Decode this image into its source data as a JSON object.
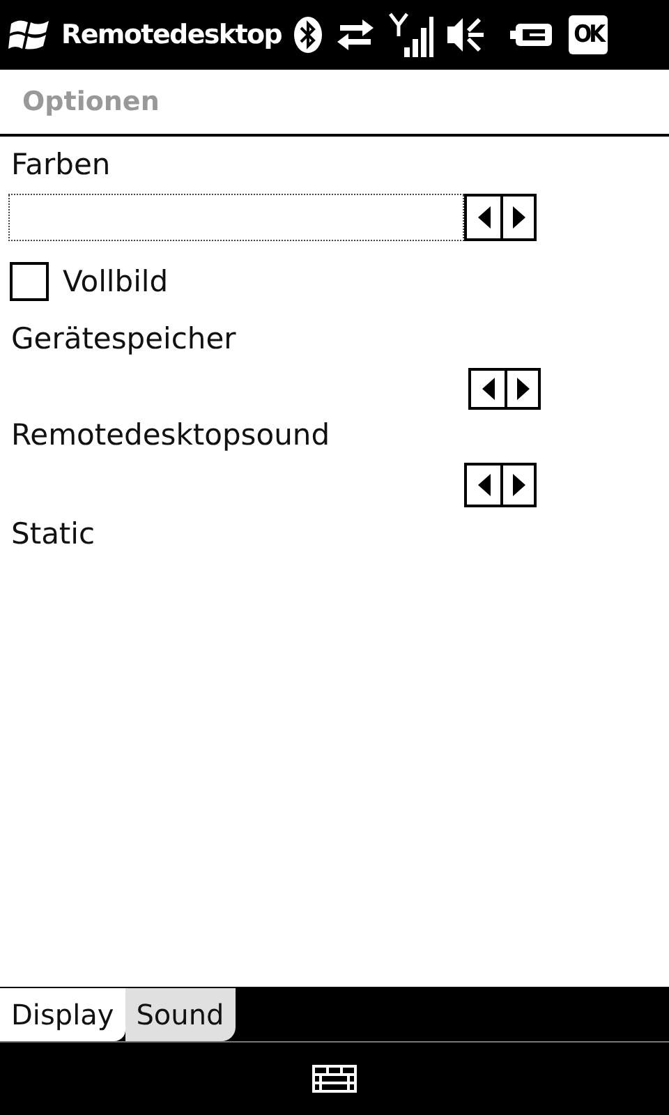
{
  "title_bar": {
    "title": "Remotedesktop",
    "ok": "OK"
  },
  "header": "Optionen",
  "controls": [
    {
      "kind": "combo",
      "label": "Farben"
    },
    {
      "kind": "checkbox",
      "label": "Vollbild",
      "checked": false
    },
    {
      "kind": "spinner",
      "label": "Gerätespeicher"
    },
    {
      "kind": "spinner",
      "label": "Remotedesktopsound"
    },
    {
      "kind": "static",
      "label": "Static"
    }
  ],
  "tabs": [
    {
      "label": "Display",
      "selected": true
    },
    {
      "label": "Sound",
      "selected": false
    }
  ]
}
